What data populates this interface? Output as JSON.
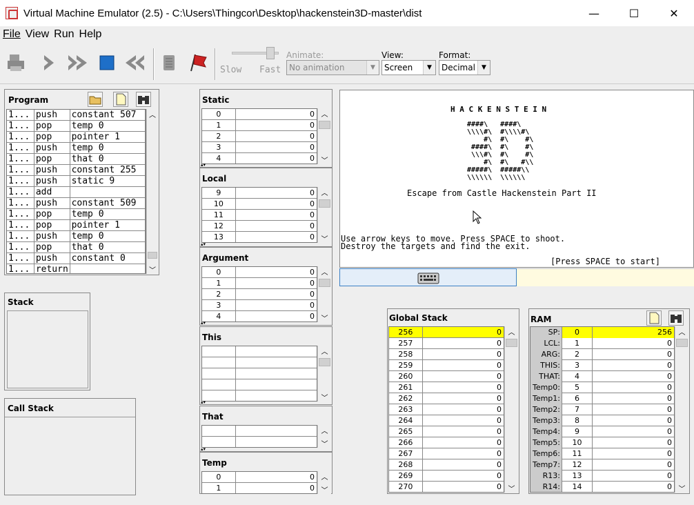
{
  "window": {
    "title": "Virtual Machine Emulator (2.5) - C:\\Users\\Thingcor\\Desktop\\hackenstein3D-master\\dist",
    "minimize": "—",
    "maximize": "☐",
    "close": "✕"
  },
  "menu": [
    {
      "label": "File"
    },
    {
      "label": "View"
    },
    {
      "label": "Run"
    },
    {
      "label": "Help"
    }
  ],
  "toolbar": {
    "slow": "Slow",
    "fast": "Fast",
    "animate_label": "Animate:",
    "animate_value": "No animation",
    "view_label": "View:",
    "view_value": "Screen",
    "format_label": "Format:",
    "format_value": "Decimal",
    "speed_level": 0.9
  },
  "program": {
    "title": "Program",
    "rows": [
      [
        "1...",
        "push",
        "constant 507"
      ],
      [
        "1...",
        "pop",
        "temp 0"
      ],
      [
        "1...",
        "pop",
        "pointer 1"
      ],
      [
        "1...",
        "push",
        "temp 0"
      ],
      [
        "1...",
        "pop",
        "that 0"
      ],
      [
        "1...",
        "push",
        "constant 255"
      ],
      [
        "1...",
        "push",
        "static 9"
      ],
      [
        "1...",
        "add",
        ""
      ],
      [
        "1...",
        "push",
        "constant 509"
      ],
      [
        "1...",
        "pop",
        "temp 0"
      ],
      [
        "1...",
        "pop",
        "pointer 1"
      ],
      [
        "1...",
        "push",
        "temp 0"
      ],
      [
        "1...",
        "pop",
        "that 0"
      ],
      [
        "1...",
        "push",
        "constant 0"
      ],
      [
        "1...",
        "return",
        ""
      ]
    ]
  },
  "stack": {
    "title": "Stack"
  },
  "call_stack": {
    "title": "Call Stack"
  },
  "segments": {
    "static": {
      "title": "Static",
      "rows": [
        [
          "0",
          "0"
        ],
        [
          "1",
          "0"
        ],
        [
          "2",
          "0"
        ],
        [
          "3",
          "0"
        ],
        [
          "4",
          "0"
        ]
      ]
    },
    "local": {
      "title": "Local",
      "rows": [
        [
          "9",
          "0"
        ],
        [
          "10",
          "0"
        ],
        [
          "11",
          "0"
        ],
        [
          "12",
          "0"
        ],
        [
          "13",
          "0"
        ]
      ]
    },
    "argument": {
      "title": "Argument",
      "rows": [
        [
          "0",
          "0"
        ],
        [
          "1",
          "0"
        ],
        [
          "2",
          "0"
        ],
        [
          "3",
          "0"
        ],
        [
          "4",
          "0"
        ]
      ]
    },
    "this": {
      "title": "This",
      "rows": [
        [
          "",
          ""
        ],
        [
          "",
          ""
        ],
        [
          "",
          ""
        ],
        [
          "",
          ""
        ],
        [
          "",
          ""
        ]
      ]
    },
    "that": {
      "title": "That",
      "rows": [
        [
          "",
          ""
        ],
        [
          "",
          ""
        ]
      ]
    },
    "temp": {
      "title": "Temp",
      "rows": [
        [
          "0",
          "0"
        ],
        [
          "1",
          "0"
        ]
      ]
    }
  },
  "screen": {
    "heading": "H A C K E N S T E I N",
    "art": "####\\   ####\\\n\\\\\\\\#\\  #\\\\\\\\#\\\n    #\\  #\\    #\\\n ####\\  #\\    #\\\n \\\\\\#\\  #\\    #\\\n    #\\  #\\   #\\\\\n#####\\  #####\\\\\n\\\\\\\\\\\\  \\\\\\\\\\\\",
    "subtitle": "Escape from Castle Hackenstein Part II",
    "line1": "Use arrow keys to move. Press SPACE to shoot.",
    "line2": "Destroy the targets and find the exit.",
    "start": "[Press SPACE to start]"
  },
  "global_stack": {
    "title": "Global Stack",
    "rows": [
      [
        "256",
        "0"
      ],
      [
        "257",
        "0"
      ],
      [
        "258",
        "0"
      ],
      [
        "259",
        "0"
      ],
      [
        "260",
        "0"
      ],
      [
        "261",
        "0"
      ],
      [
        "262",
        "0"
      ],
      [
        "263",
        "0"
      ],
      [
        "264",
        "0"
      ],
      [
        "265",
        "0"
      ],
      [
        "266",
        "0"
      ],
      [
        "267",
        "0"
      ],
      [
        "268",
        "0"
      ],
      [
        "269",
        "0"
      ],
      [
        "270",
        "0"
      ]
    ]
  },
  "ram": {
    "title": "RAM",
    "rows": [
      [
        "SP:",
        "0",
        "256"
      ],
      [
        "LCL:",
        "1",
        "0"
      ],
      [
        "ARG:",
        "2",
        "0"
      ],
      [
        "THIS:",
        "3",
        "0"
      ],
      [
        "THAT:",
        "4",
        "0"
      ],
      [
        "Temp0:",
        "5",
        "0"
      ],
      [
        "Temp1:",
        "6",
        "0"
      ],
      [
        "Temp2:",
        "7",
        "0"
      ],
      [
        "Temp3:",
        "8",
        "0"
      ],
      [
        "Temp4:",
        "9",
        "0"
      ],
      [
        "Temp5:",
        "10",
        "0"
      ],
      [
        "Temp6:",
        "11",
        "0"
      ],
      [
        "Temp7:",
        "12",
        "0"
      ],
      [
        "R13:",
        "13",
        "0"
      ],
      [
        "R14:",
        "14",
        "0"
      ]
    ]
  },
  "colors": {
    "highlight": "#ffff00",
    "stop": "#1e6fc8",
    "flag": "#cc2222"
  }
}
